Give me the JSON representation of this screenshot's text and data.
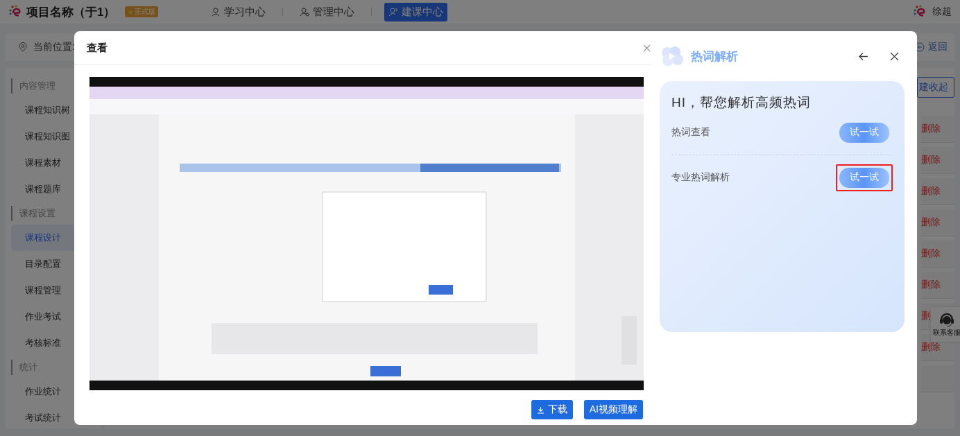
{
  "header": {
    "title": "项目名称（于1）",
    "badge": "正式版",
    "nav": [
      {
        "label": "学习中心",
        "selected": false,
        "kind": "study"
      },
      {
        "label": "管理中心",
        "selected": false,
        "kind": "manage"
      },
      {
        "label": "建课中心",
        "selected": true,
        "kind": "build"
      }
    ],
    "user": "徐超"
  },
  "breadcrumb": {
    "label": "当前位置:",
    "back": "返回"
  },
  "sidebar": {
    "groups": [
      {
        "title": "内容管理",
        "items": [
          {
            "label": "课程知识树",
            "selected": false
          },
          {
            "label": "课程知识图",
            "selected": false
          },
          {
            "label": "课程素材",
            "selected": false
          },
          {
            "label": "课程题库",
            "selected": false
          }
        ]
      },
      {
        "title": "课程设置",
        "items": [
          {
            "label": "课程设计",
            "selected": true
          },
          {
            "label": "目录配置",
            "selected": false
          },
          {
            "label": "课程管理",
            "selected": false
          },
          {
            "label": "作业考试",
            "selected": false
          },
          {
            "label": "考核标准",
            "selected": false
          }
        ]
      },
      {
        "title": "统计",
        "items": [
          {
            "label": "作业统计",
            "selected": false
          },
          {
            "label": "考试统计",
            "selected": false
          }
        ]
      }
    ]
  },
  "content": {
    "collapse_button": "建收起",
    "delete_links": [
      "删除",
      "删除",
      "删除",
      "删除",
      "删除",
      "删除",
      "删",
      "删除"
    ]
  },
  "contact": "联系客服",
  "modal": {
    "title": "查看",
    "buttons": [
      {
        "label": "下载",
        "kind": "download"
      },
      {
        "label": "AI视频理解",
        "kind": "plain"
      }
    ]
  },
  "panel": {
    "title": "热词解析",
    "card": {
      "heading": "HI，帮您解析高频热词",
      "rows": [
        {
          "label": "热词查看",
          "button": "试一试",
          "highlighted": false
        },
        {
          "label": "专业热词解析",
          "button": "试一试",
          "highlighted": true
        }
      ]
    }
  }
}
